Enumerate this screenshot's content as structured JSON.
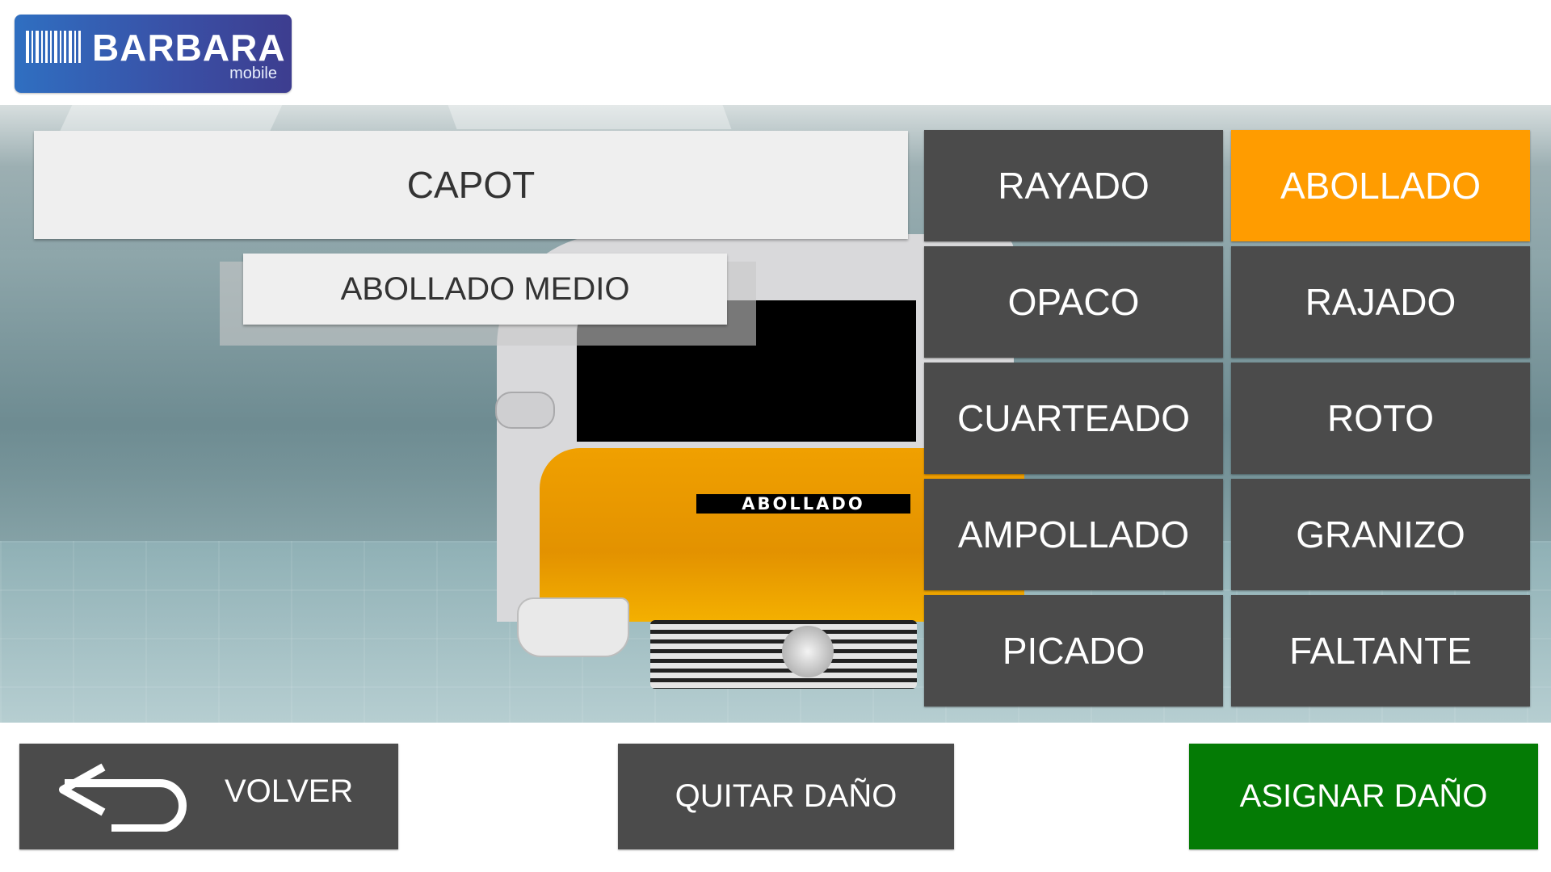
{
  "header": {
    "logo_text": "BARBARA",
    "logo_subtext": "mobile"
  },
  "part": {
    "name": "CAPOT",
    "damage_detail": "ABOLLADO MEDIO",
    "hood_label": "ABOLLADO"
  },
  "damage_types": [
    {
      "label": "RAYADO",
      "selected": false
    },
    {
      "label": "ABOLLADO",
      "selected": true
    },
    {
      "label": "OPACO",
      "selected": false
    },
    {
      "label": "RAJADO",
      "selected": false
    },
    {
      "label": "CUARTEADO",
      "selected": false
    },
    {
      "label": "ROTO",
      "selected": false
    },
    {
      "label": "AMPOLLADO",
      "selected": false
    },
    {
      "label": "GRANIZO",
      "selected": false
    },
    {
      "label": "PICADO",
      "selected": false
    },
    {
      "label": "FALTANTE",
      "selected": false
    }
  ],
  "actions": {
    "back_label": "VOLVER",
    "remove_label": "QUITAR DAÑO",
    "assign_label": "ASIGNAR DAÑO"
  },
  "colors": {
    "selected": "#ff9c00",
    "button": "#4b4b4b",
    "assign": "#047b05"
  }
}
